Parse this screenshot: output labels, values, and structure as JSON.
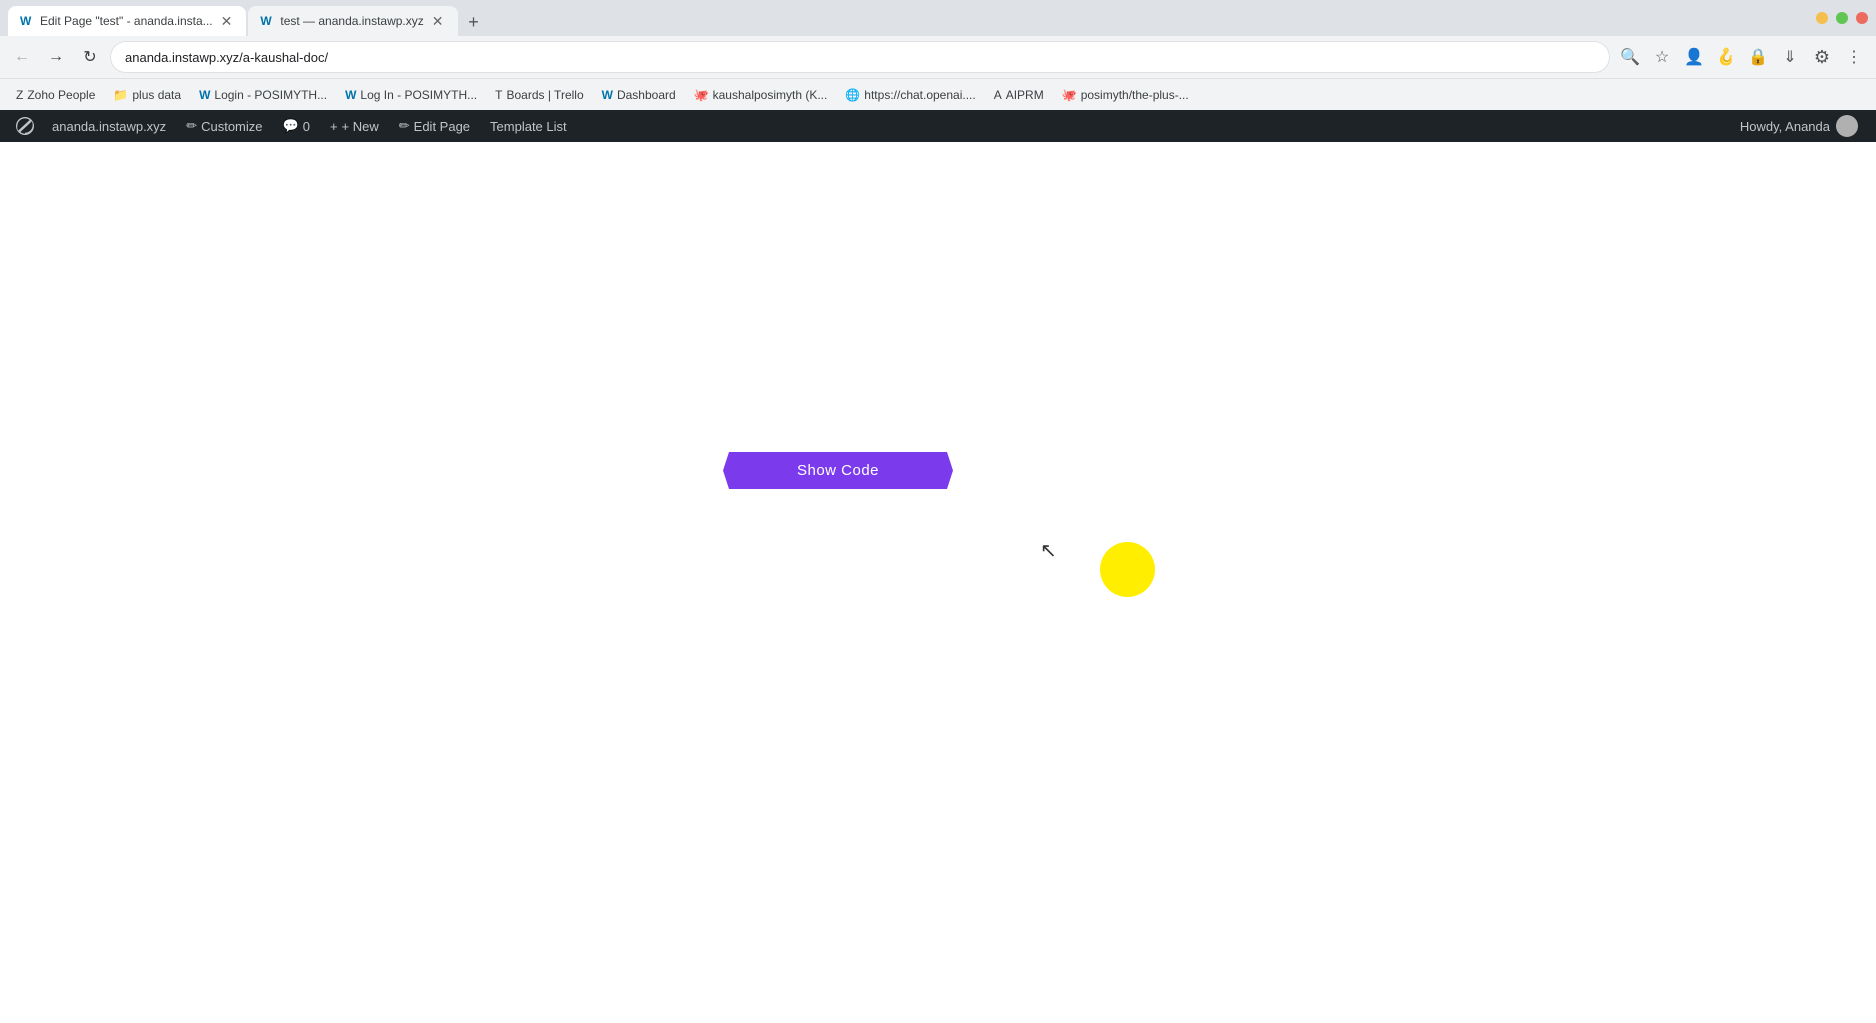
{
  "browser": {
    "tabs": [
      {
        "id": "tab1",
        "title": "Edit Page \"test\" - ananda.insta...",
        "favicon": "W",
        "active": true,
        "url": "edit page"
      },
      {
        "id": "tab2",
        "title": "test — ananda.instawp.xyz",
        "favicon": "W",
        "active": false,
        "url": "test"
      }
    ],
    "address": "ananda.instawp.xyz/a-kaushal-doc/",
    "new_tab_label": "+",
    "back_disabled": false,
    "forward_disabled": true
  },
  "bookmarks": [
    {
      "id": "bm1",
      "label": "Zoho People",
      "favicon": "Z"
    },
    {
      "id": "bm2",
      "label": "plus data",
      "favicon": "📁"
    },
    {
      "id": "bm3",
      "label": "Login - POSIMYTH...",
      "favicon": "W"
    },
    {
      "id": "bm4",
      "label": "Log In - POSIMYTH...",
      "favicon": "W"
    },
    {
      "id": "bm5",
      "label": "Boards | Trello",
      "favicon": "T"
    },
    {
      "id": "bm6",
      "label": "Dashboard",
      "favicon": "W"
    },
    {
      "id": "bm7",
      "label": "kaushalposimyth (K...",
      "favicon": "🐙"
    },
    {
      "id": "bm8",
      "label": "https://chat.openai....",
      "favicon": "🌐"
    },
    {
      "id": "bm9",
      "label": "AIPRM",
      "favicon": "A"
    },
    {
      "id": "bm10",
      "label": "posimyth/the-plus-...",
      "favicon": "🐙"
    }
  ],
  "wp_admin_bar": {
    "items": [
      {
        "id": "wp-logo",
        "label": "⊞",
        "icon": "wordpress"
      },
      {
        "id": "site-name",
        "label": "ananda.instawp.xyz"
      },
      {
        "id": "customize",
        "label": "✏ Customize"
      },
      {
        "id": "comments",
        "label": "💬 0"
      },
      {
        "id": "new",
        "label": "+ New"
      },
      {
        "id": "edit-page",
        "label": "✏ Edit Page"
      },
      {
        "id": "template-list",
        "label": "Template List"
      }
    ],
    "howdy": "Howdy, Ananda"
  },
  "page": {
    "show_code_button": "Show Code",
    "show_code_bg": "#7c3aed",
    "yellow_circle_color": "#ffee00"
  }
}
